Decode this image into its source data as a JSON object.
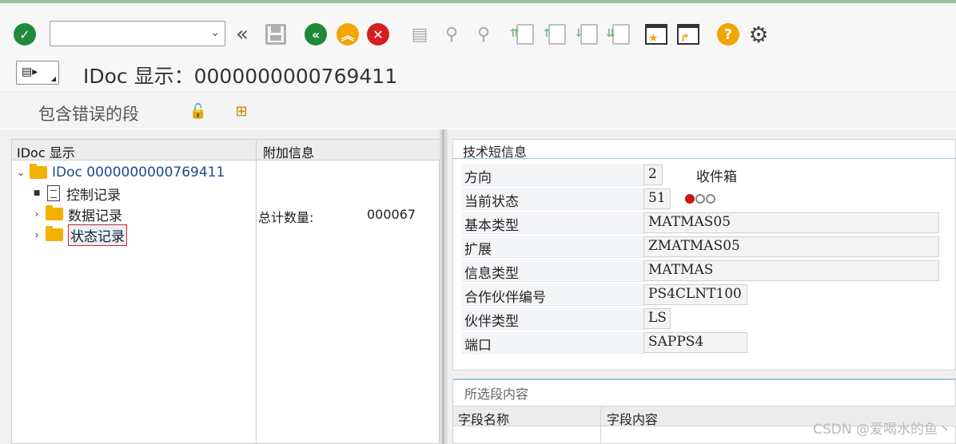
{
  "toolbar": {
    "command_value": "",
    "icons": [
      "enter-icon",
      "back-double-icon",
      "save-icon",
      "back-icon",
      "exit-icon",
      "cancel-icon",
      "print-icon",
      "find-icon",
      "find-next-icon",
      "first-page-icon",
      "prev-page-icon",
      "next-page-icon",
      "last-page-icon",
      "create-session-icon",
      "shortcut-icon",
      "help-icon",
      "settings-icon"
    ]
  },
  "title": {
    "text": "IDoc 显示：0000000000769411"
  },
  "actions": {
    "errors_label": "包含错误的段"
  },
  "tree": {
    "col1_header": "IDoc 显示",
    "col2_header": "附加信息",
    "root_label": "IDoc 0000000000769411",
    "items": [
      {
        "label": "控制记录"
      },
      {
        "label": "数据记录"
      },
      {
        "label": "状态记录"
      }
    ],
    "extra_label": "总计数量:",
    "extra_value": "000067"
  },
  "info": {
    "header": "技术短信息",
    "rows": [
      {
        "label": "方向",
        "value": "2",
        "extra": "收件箱"
      },
      {
        "label": "当前状态",
        "value": "51"
      },
      {
        "label": "基本类型",
        "value": "MATMAS05"
      },
      {
        "label": "扩展",
        "value": "ZMATMAS05"
      },
      {
        "label": "信息类型",
        "value": "MATMAS"
      },
      {
        "label": "合作伙伴编号",
        "value": "PS4CLNT100"
      },
      {
        "label": "伙伴类型",
        "value": "LS"
      },
      {
        "label": "端口",
        "value": "SAPPS4"
      }
    ],
    "status_lights": {
      "active": "red",
      "colors": [
        "#c81414",
        "#888888",
        "#888888"
      ]
    }
  },
  "selected_content": {
    "header": "所选段内容",
    "col1": "字段名称",
    "col2": "字段内容"
  },
  "watermark": "CSDN @爱喝水的鱼丶"
}
